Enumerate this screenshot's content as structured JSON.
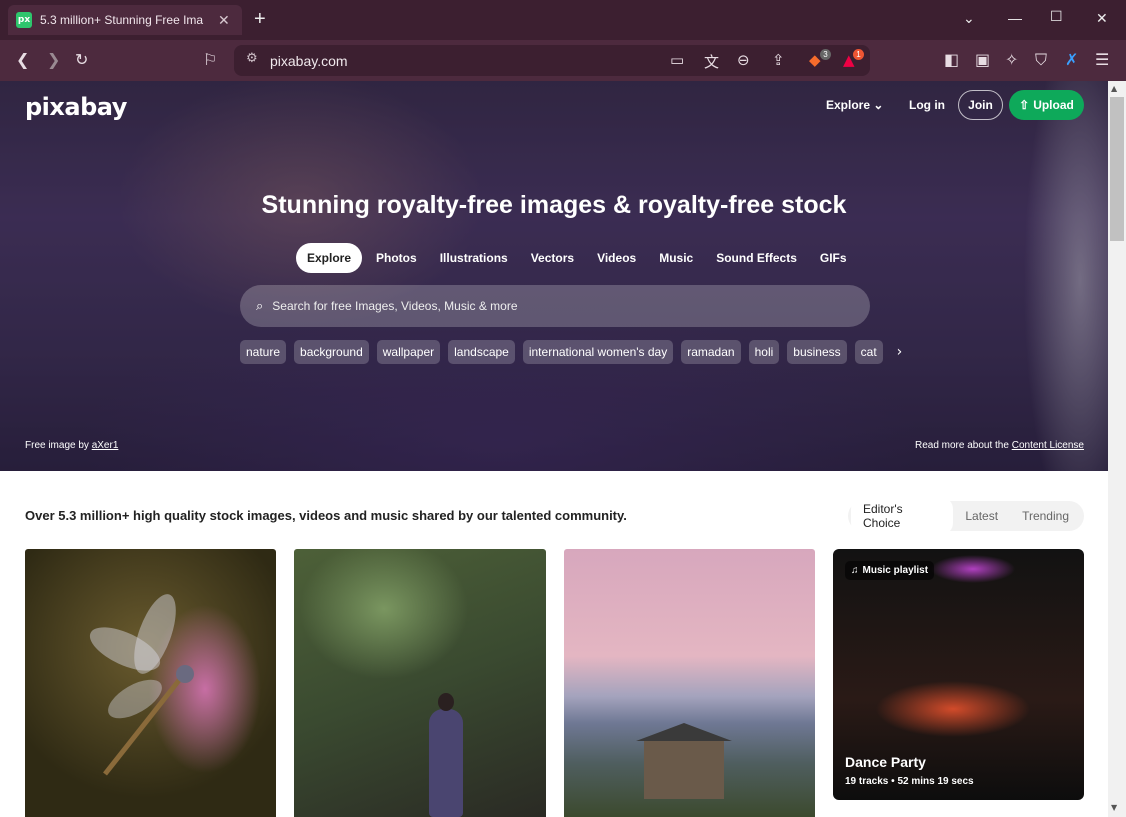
{
  "browser": {
    "tab_title": "5.3 million+ Stunning Free Ima",
    "favicon_text": "px",
    "url": "pixabay.com",
    "brave_badge": "3",
    "alert_badge": "1"
  },
  "site": {
    "logo": "pixabay",
    "nav": {
      "explore": "Explore",
      "login": "Log in",
      "join": "Join",
      "upload": "Upload"
    }
  },
  "hero": {
    "headline": "Stunning royalty-free images & royalty-free stock",
    "categories": [
      "Explore",
      "Photos",
      "Illustrations",
      "Vectors",
      "Videos",
      "Music",
      "Sound Effects",
      "GIFs"
    ],
    "search_placeholder": "Search for free Images, Videos, Music & more",
    "tags": [
      "nature",
      "background",
      "wallpaper",
      "landscape",
      "international women's day",
      "ramadan",
      "holi",
      "business",
      "cat"
    ],
    "credit_prefix": "Free image by ",
    "credit_author": "aXer1",
    "license_prefix": "Read more about the ",
    "license_link": "Content License"
  },
  "content": {
    "tagline": "Over 5.3 million+ high quality stock images, videos and music shared by our talented community.",
    "sort_options": [
      "Editor's Choice",
      "Latest",
      "Trending"
    ],
    "playlist": {
      "badge": "Music playlist",
      "title": "Dance Party",
      "tracks": "19 tracks",
      "duration": "52 mins 19 secs"
    }
  }
}
